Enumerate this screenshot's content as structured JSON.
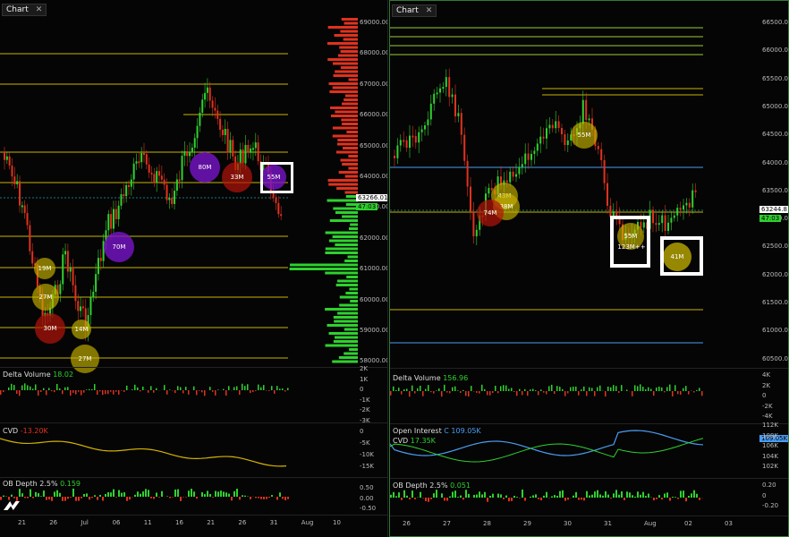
{
  "left": {
    "tab_label": "Chart",
    "price_ticks": [
      "69000.00",
      "68000.00",
      "67000.00",
      "66000.00",
      "65000.00",
      "64000.00",
      "63000.00",
      "62000.00",
      "61000.00",
      "60000.00",
      "59000.00",
      "58000.00"
    ],
    "last_price": "63266.01",
    "countdown": "47:03",
    "bubbles": [
      "19M",
      "27M",
      "30M",
      "14M",
      "27M",
      "70M",
      "80M",
      "33M",
      "55M"
    ],
    "delta": {
      "label": "Delta Volume",
      "value": "18.02",
      "ticks": [
        "2K",
        "1K",
        "0",
        "-1K",
        "-2K",
        "-3K"
      ]
    },
    "cvd": {
      "label": "CVD",
      "value": "-13.20K",
      "ticks": [
        "0",
        "-5K",
        "-10K",
        "-15K"
      ]
    },
    "ob": {
      "label": "OB Depth 2.5%",
      "value": "0.159",
      "ticks": [
        "0.50",
        "0.00",
        "-0.50"
      ]
    },
    "dates": [
      "21",
      "26",
      "Jul",
      "06",
      "11",
      "16",
      "21",
      "26",
      "31",
      "Aug",
      "10"
    ]
  },
  "right": {
    "tab_label": "Chart",
    "price_ticks": [
      "66500.00",
      "66000.00",
      "65500.00",
      "65000.00",
      "64500.00",
      "64000.00",
      "63500.00",
      "63000.00",
      "62500.00",
      "62000.00",
      "61500.00",
      "61000.00",
      "60500.00"
    ],
    "last_price": "63244.8",
    "countdown": "47:03",
    "bubbles": [
      "43M",
      "38M",
      "74M",
      "55M",
      "55M",
      "123M++",
      "41M"
    ],
    "delta": {
      "label": "Delta Volume",
      "value": "156.96",
      "ticks": [
        "4K",
        "2K",
        "0",
        "-2K",
        "-4K"
      ]
    },
    "oi": {
      "label": "Open Interest",
      "value": "C 109.05K",
      "tag": "109.05K",
      "ticks": [
        "112K",
        "108K",
        "106K",
        "104K",
        "102K"
      ]
    },
    "cvd": {
      "label": "CVD",
      "value": "17.35K"
    },
    "ob": {
      "label": "OB Depth 2.5%",
      "value": "0.051",
      "ticks": [
        "0.20",
        "0",
        "-0.20"
      ]
    },
    "dates": [
      "26",
      "27",
      "28",
      "29",
      "30",
      "31",
      "Aug",
      "02",
      "03"
    ]
  },
  "colors": {
    "up": "#2fd12f",
    "down": "#e0321e",
    "level": "#c8b400",
    "cvd": "#d4b400",
    "oi": "#4a9df0"
  }
}
